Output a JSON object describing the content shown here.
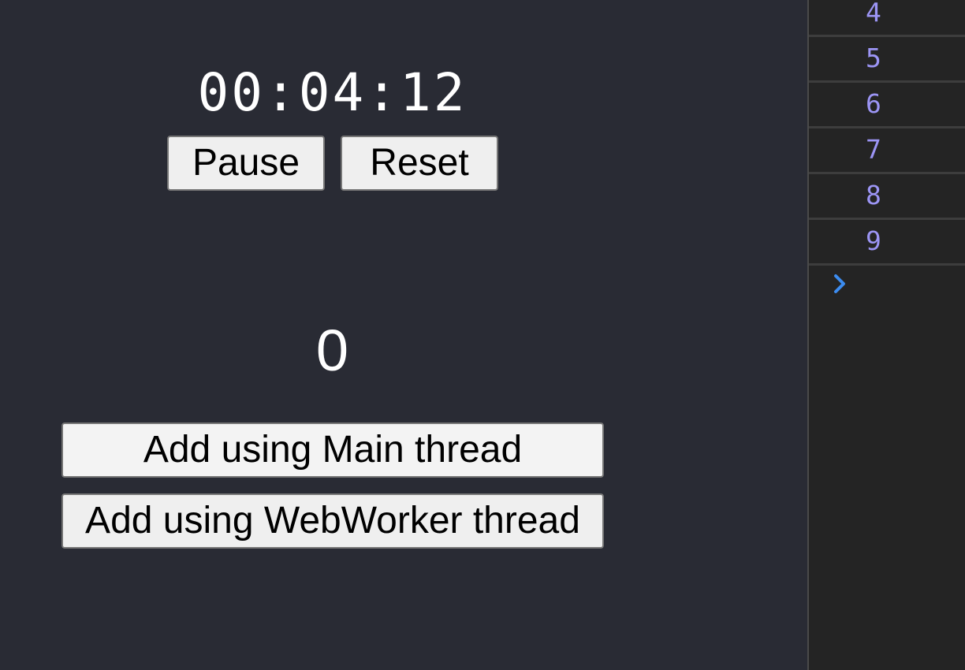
{
  "timer": {
    "display": "00:04:12",
    "pause_label": "Pause",
    "reset_label": "Reset"
  },
  "counter": {
    "value": "0"
  },
  "actions": {
    "main_thread_label": "Add using Main thread",
    "webworker_thread_label": "Add using WebWorker thread"
  },
  "console": {
    "logs": [
      "4",
      "5",
      "6",
      "7",
      "8",
      "9"
    ],
    "prompt_icon": "chevron-right-icon",
    "value_color": "#9c95f5",
    "prompt_color": "#3c8cf0"
  },
  "colors": {
    "page_background": "#292b34",
    "console_background": "#242424"
  }
}
